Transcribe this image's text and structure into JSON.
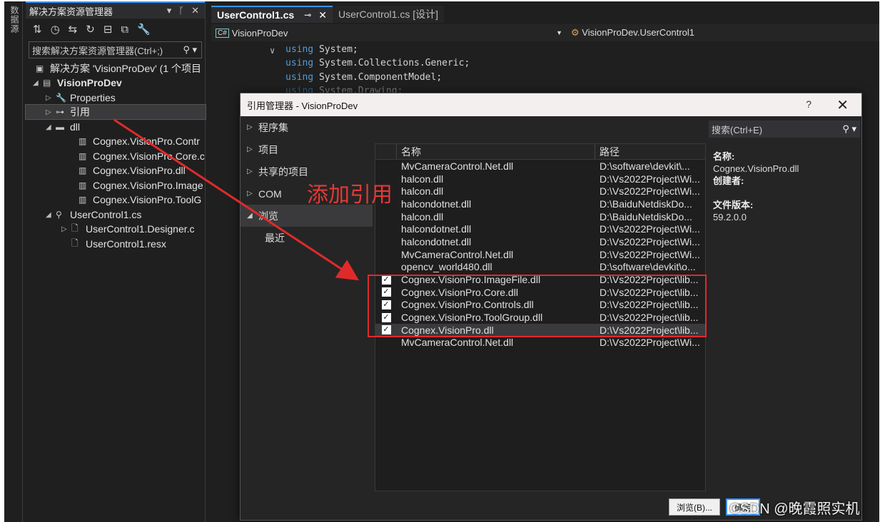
{
  "sidebar_strip": {
    "label": "数据源"
  },
  "solution_explorer": {
    "title": "解决方案资源管理器",
    "search_placeholder": "搜索解决方案资源管理器(Ctrl+;)",
    "items": [
      {
        "label": "解决方案 'VisionProDev' (1 个项目",
        "icon": "solution-icon"
      },
      {
        "label": "VisionProDev",
        "icon": "csharp-project-icon"
      },
      {
        "label": "Properties",
        "icon": "wrench-icon"
      },
      {
        "label": "引用",
        "icon": "references-icon"
      },
      {
        "label": "dll",
        "icon": "folder-icon"
      },
      {
        "label": "Cognex.VisionPro.Contr",
        "icon": "library-icon"
      },
      {
        "label": "Cognex.VisionPro.Core.c",
        "icon": "library-icon"
      },
      {
        "label": "Cognex.VisionPro.dll",
        "icon": "library-icon"
      },
      {
        "label": "Cognex.VisionPro.Image",
        "icon": "library-icon"
      },
      {
        "label": "Cognex.VisionPro.ToolG",
        "icon": "library-icon"
      },
      {
        "label": "UserControl1.cs",
        "icon": "usercontrol-icon"
      },
      {
        "label": "UserControl1.Designer.c",
        "icon": "file-icon"
      },
      {
        "label": "UserControl1.resx",
        "icon": "file-icon"
      }
    ]
  },
  "editor": {
    "tabs": [
      "UserControl1.cs",
      "UserControl1.cs [设计]"
    ],
    "nav_left": "VisionProDev",
    "nav_right": "VisionProDev.UserControl1",
    "code_lines": [
      {
        "kw": "using",
        "text": "System;"
      },
      {
        "kw": "using",
        "text": "System.Collections.Generic;"
      },
      {
        "kw": "using",
        "text": "System.ComponentModel;"
      },
      {
        "kw": "using",
        "text": "System.Drawing;"
      }
    ]
  },
  "dialog": {
    "title": "引用管理器 - VisionProDev",
    "help": "?",
    "categories": [
      "程序集",
      "项目",
      "共享的项目",
      "COM",
      "浏览",
      "最近"
    ],
    "search_placeholder": "搜索(Ctrl+E)",
    "columns": {
      "name": "名称",
      "path": "路径"
    },
    "rows": [
      {
        "checked": false,
        "name": "MvCameraControl.Net.dll",
        "path": "D:\\software\\devkit\\..."
      },
      {
        "checked": false,
        "name": "halcon.dll",
        "path": "D:\\Vs2022Project\\Wi..."
      },
      {
        "checked": false,
        "name": "halcon.dll",
        "path": "D:\\Vs2022Project\\Wi..."
      },
      {
        "checked": false,
        "name": "halcondotnet.dll",
        "path": "D:\\BaiduNetdiskDo..."
      },
      {
        "checked": false,
        "name": "halcon.dll",
        "path": "D:\\BaiduNetdiskDo..."
      },
      {
        "checked": false,
        "name": "halcondotnet.dll",
        "path": "D:\\Vs2022Project\\Wi..."
      },
      {
        "checked": false,
        "name": "halcondotnet.dll",
        "path": "D:\\Vs2022Project\\Wi..."
      },
      {
        "checked": false,
        "name": "MvCameraControl.Net.dll",
        "path": "D:\\Vs2022Project\\Wi..."
      },
      {
        "checked": false,
        "name": "opencv_world480.dll",
        "path": "D:\\software\\devkit\\o..."
      },
      {
        "checked": true,
        "name": "Cognex.VisionPro.ImageFile.dll",
        "path": "D:\\Vs2022Project\\lib..."
      },
      {
        "checked": true,
        "name": "Cognex.VisionPro.Core.dll",
        "path": "D:\\Vs2022Project\\lib..."
      },
      {
        "checked": true,
        "name": "Cognex.VisionPro.Controls.dll",
        "path": "D:\\Vs2022Project\\lib..."
      },
      {
        "checked": true,
        "name": "Cognex.VisionPro.ToolGroup.dll",
        "path": "D:\\Vs2022Project\\lib..."
      },
      {
        "checked": true,
        "name": "Cognex.VisionPro.dll",
        "path": "D:\\Vs2022Project\\lib..."
      },
      {
        "checked": false,
        "name": "MvCameraControl.Net.dll",
        "path": "D:\\Vs2022Project\\Wi..."
      }
    ],
    "details": {
      "name_label": "名称:",
      "name_value": "Cognex.VisionPro.dll",
      "creator_label": "创建者:",
      "version_label": "文件版本:",
      "version_value": "59.2.0.0"
    },
    "buttons": {
      "browse": "浏览(B)...",
      "ok": "确定"
    }
  },
  "annotation": {
    "text": "添加引用",
    "color": "#e53935"
  },
  "watermark": "CSDN @晚霞照实机"
}
